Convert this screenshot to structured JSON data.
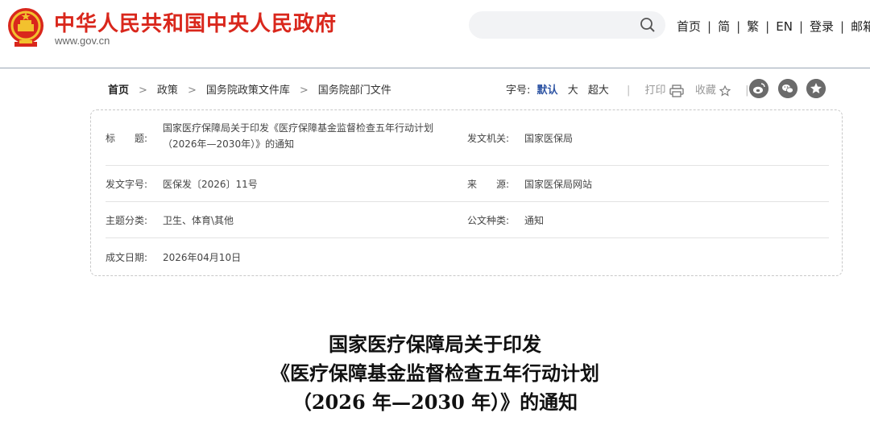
{
  "header": {
    "site_title": "中华人民共和国中央人民政府",
    "site_domain": "www.gov.cn",
    "search_placeholder": "",
    "nav": [
      "首页",
      "简",
      "繁",
      "EN",
      "登录",
      "邮箱"
    ]
  },
  "breadcrumb": [
    "首页",
    "政策",
    "国务院政策文件库",
    "国务院部门文件"
  ],
  "tools": {
    "font_label": "字号:",
    "font_default": "默认",
    "font_large": "大",
    "font_xlarge": "超大",
    "print_label": "打印",
    "favorite_label": "收藏"
  },
  "info": {
    "title_label": "标　　题:",
    "title_value_line1": "国家医疗保障局关于印发《医疗保障基金监督检查五年行动计划",
    "title_value_line2": "（2026年—2030年）》的通知",
    "issuer_label": "发文机关:",
    "issuer_value": "国家医保局",
    "doc_no_label": "发文字号:",
    "doc_no_value": "医保发〔2026〕11号",
    "source_label": "来　　源:",
    "source_value": "国家医保局网站",
    "category_label": "主题分类:",
    "category_value": "卫生、体育\\其他",
    "type_label": "公文种类:",
    "type_value": "通知",
    "date_label": "成文日期:",
    "date_value": "2026年04月10日"
  },
  "document": {
    "title_line1": "国家医疗保障局关于印发",
    "title_line2": "《医疗保障基金监督检查五年行动计划",
    "title_line3": "（2026 年—2030 年）》的通知"
  },
  "colors": {
    "brand_red": "#d9271c",
    "link_blue": "#2f55a4"
  }
}
